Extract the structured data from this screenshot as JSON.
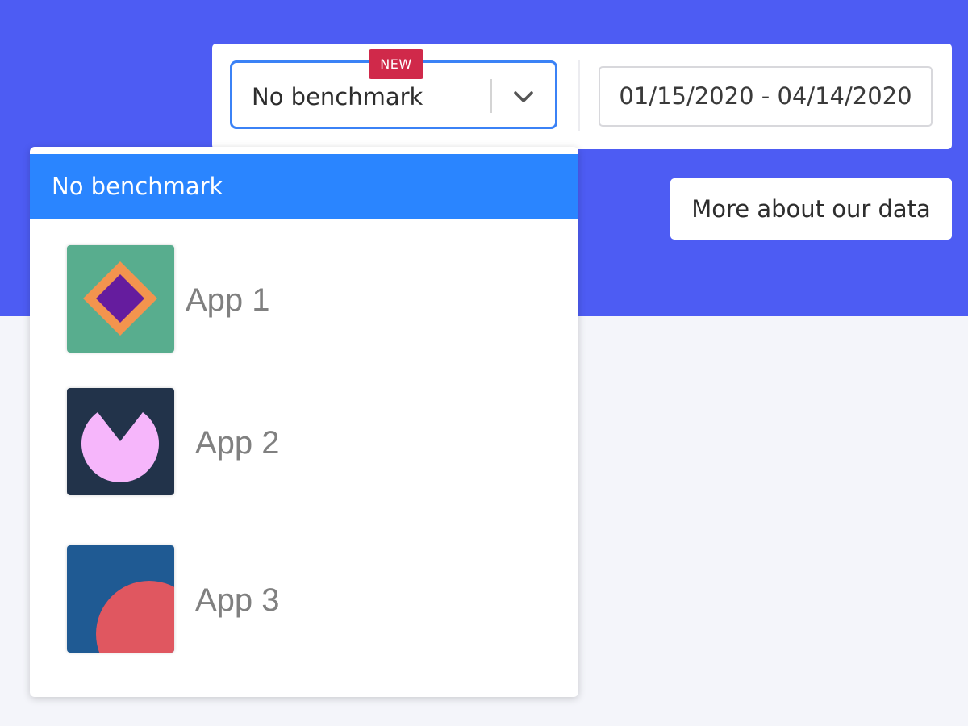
{
  "benchmark_select": {
    "badge": "NEW",
    "value": "No benchmark",
    "focus_color": "#3b82f6"
  },
  "date_range": {
    "value": "01/15/2020 - 04/14/2020"
  },
  "more_button": {
    "label": "More about our data"
  },
  "dropdown": {
    "selected_option": "No benchmark",
    "selected_color": "#2a85ff",
    "options": [
      {
        "label": "App 1",
        "icon": "diamond-icon",
        "icon_colors": [
          "#58ad8e",
          "#f3944e",
          "#651c9e"
        ]
      },
      {
        "label": "App 2",
        "icon": "pacman-icon",
        "icon_colors": [
          "#22334a",
          "#f6b6fb"
        ]
      },
      {
        "label": "App 3",
        "icon": "circle-icon",
        "icon_colors": [
          "#1f5a93",
          "#e05760"
        ]
      }
    ]
  },
  "colors": {
    "banner": "#4d5cf3",
    "background": "#f4f5fa",
    "badge": "#d0294a"
  }
}
